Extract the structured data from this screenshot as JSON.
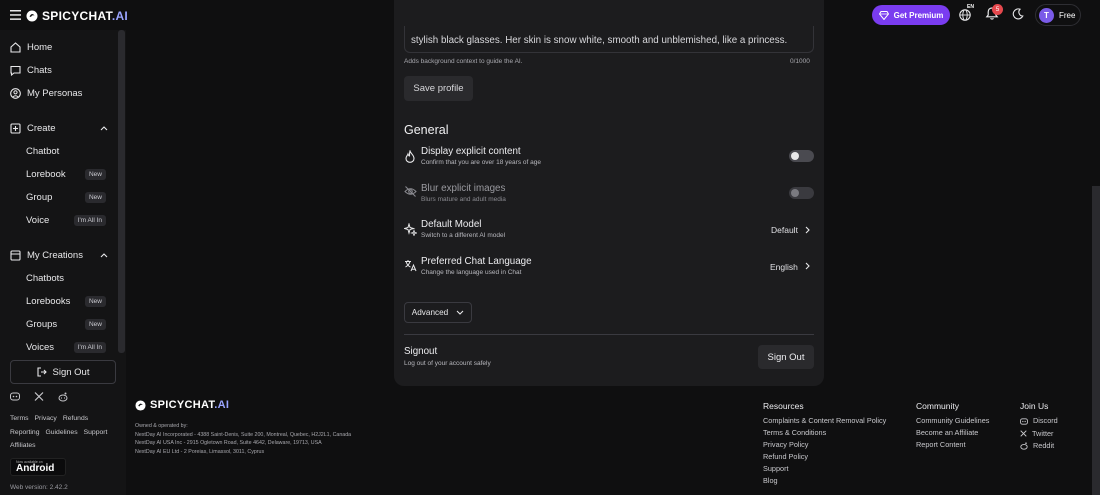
{
  "header": {
    "brand_main": "SPICYCHAT",
    "brand_ai": ".AI",
    "premium_label": "Get Premium",
    "lang_code": "EN",
    "notification_count": "5",
    "user_initial": "T",
    "plan_label": "Free"
  },
  "sidebar": {
    "home": "Home",
    "chats": "Chats",
    "personas": "My Personas",
    "create": "Create",
    "create_items": [
      {
        "label": "Chatbot",
        "badge": ""
      },
      {
        "label": "Lorebook",
        "badge": "New"
      },
      {
        "label": "Group",
        "badge": "New"
      },
      {
        "label": "Voice",
        "badge": "I'm All In"
      }
    ],
    "my_creations": "My Creations",
    "creation_items": [
      {
        "label": "Chatbots",
        "badge": ""
      },
      {
        "label": "Lorebooks",
        "badge": "New"
      },
      {
        "label": "Groups",
        "badge": "New"
      },
      {
        "label": "Voices",
        "badge": "I'm All In"
      }
    ],
    "sign_out": "Sign Out",
    "links_row1": [
      "Terms",
      "Privacy",
      "Refunds"
    ],
    "links_row2": [
      "Reporting",
      "Guidelines",
      "Support"
    ],
    "links_row3": [
      "Affiliates"
    ],
    "android_small": "Now available on",
    "android_big": "Android",
    "web_version": "Web version: 2.42.2"
  },
  "main": {
    "textarea_text": "stylish black glasses. Her skin is snow white, smooth and unblemished, like a princess.",
    "help_text": "Adds background context to guide the AI.",
    "counter": "0/1000",
    "save_label": "Save profile",
    "section_title": "General",
    "rows": [
      {
        "title": "Display explicit content",
        "desc": "Confirm that you are over 18 years of age",
        "value": ""
      },
      {
        "title": "Blur explicit images",
        "desc": "Blurs mature and adult media",
        "value": ""
      },
      {
        "title": "Default Model",
        "desc": "Switch to a different AI model",
        "value": "Default"
      },
      {
        "title": "Preferred Chat Language",
        "desc": "Change the language used in Chat",
        "value": "English"
      }
    ],
    "advanced_label": "Advanced",
    "signout_title": "Signout",
    "signout_desc": "Log out of your account safely",
    "signout_button": "Sign Out"
  },
  "footer": {
    "legal_lines": [
      "Owned & operated by:",
      "NextDay AI Incorporated - 4388 Saint-Denis, Suite 200, Montreal, Quebec, H2J2L1, Canada",
      "NextDay AI USA Inc - 2915 Ogletown Road, Suite 4642, Delaware, 19713, USA",
      "NextDay AI EU Ltd - 2 Poreias, Limassol, 3011, Cyprus"
    ],
    "resources_title": "Resources",
    "resources": [
      "Complaints & Content Removal Policy",
      "Terms & Conditions",
      "Privacy Policy",
      "Refund Policy",
      "Support",
      "Blog"
    ],
    "community_title": "Community",
    "community": [
      "Community Guidelines",
      "Become an Affiliate",
      "Report Content"
    ],
    "join_title": "Join Us",
    "join": [
      "Discord",
      "Twitter",
      "Reddit"
    ]
  }
}
